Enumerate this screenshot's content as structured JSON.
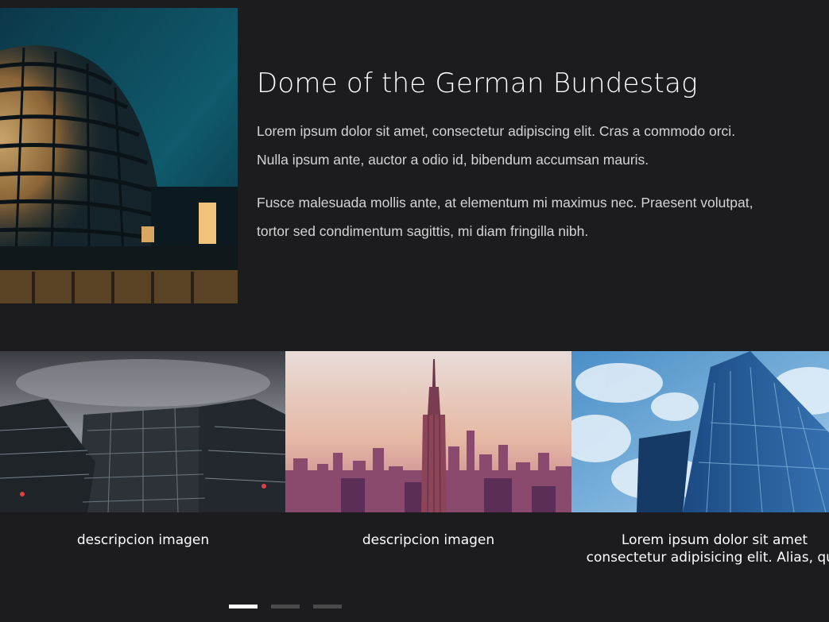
{
  "hero": {
    "title": "Dome of the German Bundestag",
    "paragraph_1": {
      "line_1": "Lorem ipsum dolor sit amet, consectetur adipiscing elit. Cras a commodo orci.",
      "line_2": "Nulla ipsum ante, auctor a odio id, bibendum accumsan mauris."
    },
    "paragraph_2": {
      "line_1": "Fusce malesuada mollis ante, at elementum mi maximus nec. Praesent volutpat,",
      "line_2": "tortor sed condimentum sagittis, mi diam fringilla nibh."
    }
  },
  "carousel": {
    "slides": [
      {
        "caption": "descripcion imagen"
      },
      {
        "caption": "descripcion imagen"
      },
      {
        "caption_line_1": "Lorem ipsum dolor sit amet",
        "caption_line_2": "consectetur adipisicing elit. Alias, quo"
      }
    ],
    "indicators": {
      "count": 3,
      "active_index": 0
    }
  },
  "colors": {
    "background": "#1c1c1e",
    "text_primary": "#ffffff",
    "text_secondary": "#d4d4d4",
    "indicator_active": "#ffffff",
    "indicator_inactive": "#4a4a4a"
  }
}
